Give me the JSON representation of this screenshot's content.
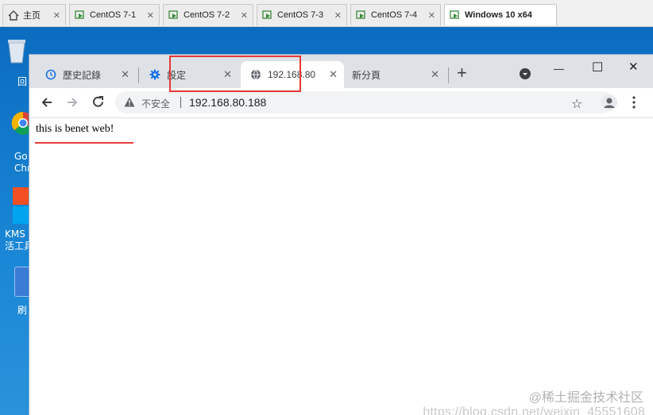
{
  "vm_tabs": [
    {
      "label": "主页",
      "icon": "home-icon",
      "active": false
    },
    {
      "label": "CentOS 7-1",
      "icon": "vm-icon",
      "active": false
    },
    {
      "label": "CentOS 7-2",
      "icon": "vm-icon",
      "active": false
    },
    {
      "label": "CentOS 7-3",
      "icon": "vm-icon",
      "active": false
    },
    {
      "label": "CentOS 7-4",
      "icon": "vm-icon",
      "active": false
    },
    {
      "label": "Windows 10 x64",
      "icon": "vm-icon",
      "active": true
    }
  ],
  "desktop": {
    "icons": [
      {
        "label": "回",
        "name": "recycle-bin"
      },
      {
        "label": "Go\nChr",
        "name": "google-chrome"
      },
      {
        "label": "KMS\n活工具",
        "name": "kms-tool"
      },
      {
        "label": "刷",
        "name": "refresh-tool"
      }
    ]
  },
  "chrome": {
    "tabs": [
      {
        "label": "歷史記錄",
        "icon": "history-icon",
        "active": false
      },
      {
        "label": "設定",
        "icon": "settings-icon",
        "active": false
      },
      {
        "label": "192.168.80",
        "icon": "globe-icon",
        "active": true
      },
      {
        "label": "新分頁",
        "icon": "",
        "active": false
      }
    ],
    "new_tab": "+",
    "window_controls": {
      "minimize": "—",
      "maximize": "☐",
      "close": "✕"
    },
    "omnibox": {
      "security_label": "不安全",
      "url": "192.168.80.188"
    },
    "page": {
      "body_text": "this is benet web!"
    }
  },
  "watermark": "https://blog.csdn.net/weixin_45551608",
  "watermark2": "@稀土掘金技术社区"
}
